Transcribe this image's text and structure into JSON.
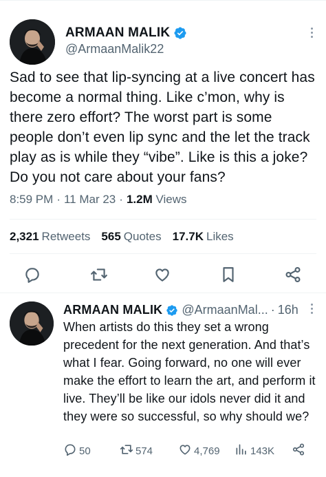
{
  "main_tweet": {
    "author_name": "ARMAAN MALIK",
    "author_handle": "@ArmaanMalik22",
    "text": "Sad to see that lip-syncing at a live concert has become a normal thing. Like c’mon, why is there zero effort? The worst part is some people don’t even lip sync and the let the track play as is while they “vibe”. Like is this a joke? Do you not care about your fans?",
    "time": "8:59 PM",
    "date": "11 Mar 23",
    "views_count": "1.2M",
    "views_label": "Views",
    "separator": "·",
    "retweets_count": "2,321",
    "retweets_label": "Retweets",
    "quotes_count": "565",
    "quotes_label": "Quotes",
    "likes_count": "17.7K",
    "likes_label": "Likes"
  },
  "reply_tweet": {
    "author_name": "ARMAAN MALIK",
    "author_handle": "@ArmaanMal...",
    "separator": "·",
    "time_ago": "16h",
    "text": "When artists do this they set a wrong precedent for the next generation. And that’s what I fear. Going forward, no one will ever make the effort to learn the art, and perform it live. They’ll be like our idols never did it and they were so successful, so why should we?",
    "replies": "50",
    "retweets": "574",
    "likes": "4,769",
    "views": "143K"
  },
  "colors": {
    "verified": "#1d9bf0",
    "secondary_text": "#536471",
    "primary_text": "#0f1419",
    "divider": "#eff3f4"
  },
  "icons": [
    "verified-badge-icon",
    "more-icon",
    "reply-icon",
    "retweet-icon",
    "like-icon",
    "bookmark-icon",
    "share-icon",
    "views-icon"
  ]
}
